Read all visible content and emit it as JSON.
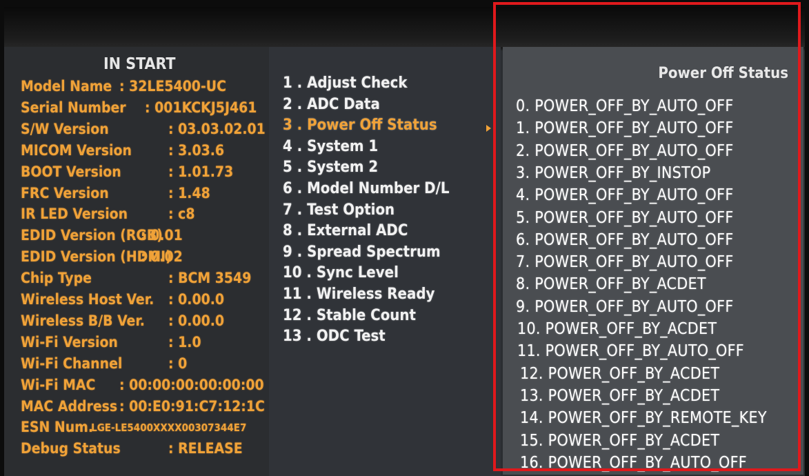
{
  "left": {
    "title": "IN START",
    "rows": [
      {
        "label": "Model Name",
        "value": ": 32LE5400-UC"
      },
      {
        "label": "Serial Number",
        "value": ": 001KCKJ5J461"
      },
      {
        "label": "S/W Version",
        "value": ": 03.03.02.01"
      },
      {
        "label": "MICOM Version",
        "value": ": 3.03.6"
      },
      {
        "label": "BOOT Version",
        "value": ": 1.01.73"
      },
      {
        "label": "FRC Version",
        "value": ": 1.48"
      },
      {
        "label": "IR LED Version",
        "value": ": c8"
      },
      {
        "label": "EDID Version (RGB)",
        "value": ": 0.01"
      },
      {
        "label": "EDID Version (HDMI)",
        "value": ": 0.02"
      },
      {
        "label": "Chip Type",
        "value": ": BCM 3549"
      },
      {
        "label": "Wireless Host Ver.",
        "value": ": 0.00.0"
      },
      {
        "label": "Wireless B/B Ver.",
        "value": ": 0.00.0"
      },
      {
        "label": "Wi-Fi Version",
        "value": ": 1.0"
      },
      {
        "label": "Wi-Fi Channel",
        "value": ": 0"
      },
      {
        "label": "Wi-Fi MAC",
        "value": ": 00:00:00:00:00:00"
      },
      {
        "label": "MAC Address",
        "value": ": 00:E0:91:C7:12:1C"
      },
      {
        "label": "ESN Num.",
        "value": ": LGE-LE5400XXXX00307344E7"
      },
      {
        "label": "Debug Status",
        "value": ": RELEASE"
      }
    ]
  },
  "menu": {
    "items": [
      "1 . Adjust Check",
      "2 . ADC Data",
      "3 . Power Off Status",
      "4 . System 1",
      "5 . System 2",
      "6 . Model Number D/L",
      "7 . Test Option",
      "8 . External ADC",
      "9 . Spread Spectrum",
      "10 . Sync Level",
      "11 . Wireless Ready",
      "12 . Stable Count",
      "13 . ODC Test"
    ],
    "selected_index": 2
  },
  "power_off": {
    "title": "Power Off Status",
    "entries": [
      "0. POWER_OFF_BY_AUTO_OFF",
      "1. POWER_OFF_BY_AUTO_OFF",
      "2. POWER_OFF_BY_AUTO_OFF",
      "3. POWER_OFF_BY_INSTOP",
      "4. POWER_OFF_BY_AUTO_OFF",
      "5. POWER_OFF_BY_AUTO_OFF",
      "6. POWER_OFF_BY_AUTO_OFF",
      "7. POWER_OFF_BY_AUTO_OFF",
      "8. POWER_OFF_BY_ACDET",
      "9. POWER_OFF_BY_AUTO_OFF",
      "10. POWER_OFF_BY_ACDET",
      "11. POWER_OFF_BY_AUTO_OFF",
      "12. POWER_OFF_BY_ACDET",
      "13. POWER_OFF_BY_ACDET",
      "14. POWER_OFF_BY_REMOTE_KEY",
      "15. POWER_OFF_BY_ACDET",
      "16. POWER_OFF_BY_AUTO_OFF"
    ]
  },
  "colors": {
    "accent": "#f0a238",
    "highlight_box": "#e0191c"
  }
}
